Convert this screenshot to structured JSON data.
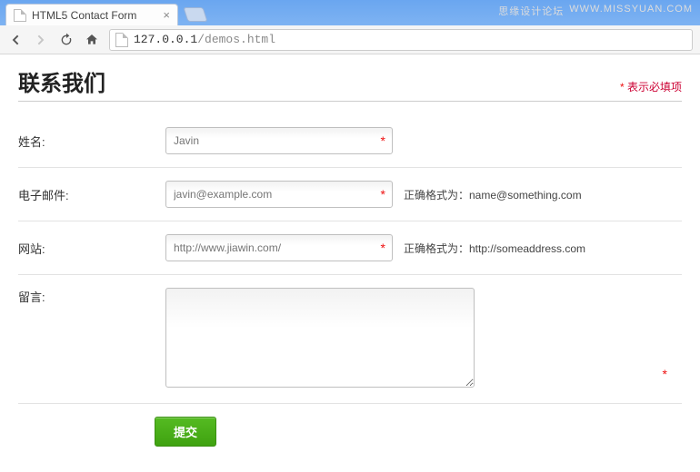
{
  "browser": {
    "tab_title": "HTML5 Contact Form",
    "url_host": "127.0.0.1",
    "url_path": "/demos.html"
  },
  "watermark": {
    "cn": "思缘设计论坛",
    "en": "WWW.MISSYUAN.COM"
  },
  "page": {
    "title": "联系我们",
    "required_note_star": "*",
    "required_note_text": "表示必填项"
  },
  "fields": {
    "name": {
      "label": "姓名:",
      "placeholder": "Javin",
      "value": ""
    },
    "email": {
      "label": "电子邮件:",
      "placeholder": "javin@example.com",
      "value": "",
      "hint": "正确格式为：name@something.com"
    },
    "website": {
      "label": "网站:",
      "placeholder": "http://www.jiawin.com/",
      "value": "",
      "hint": "正确格式为：http://someaddress.com"
    },
    "message": {
      "label": "留言:",
      "placeholder": "",
      "value": ""
    }
  },
  "submit": {
    "label": "提交"
  },
  "required_star": "*"
}
